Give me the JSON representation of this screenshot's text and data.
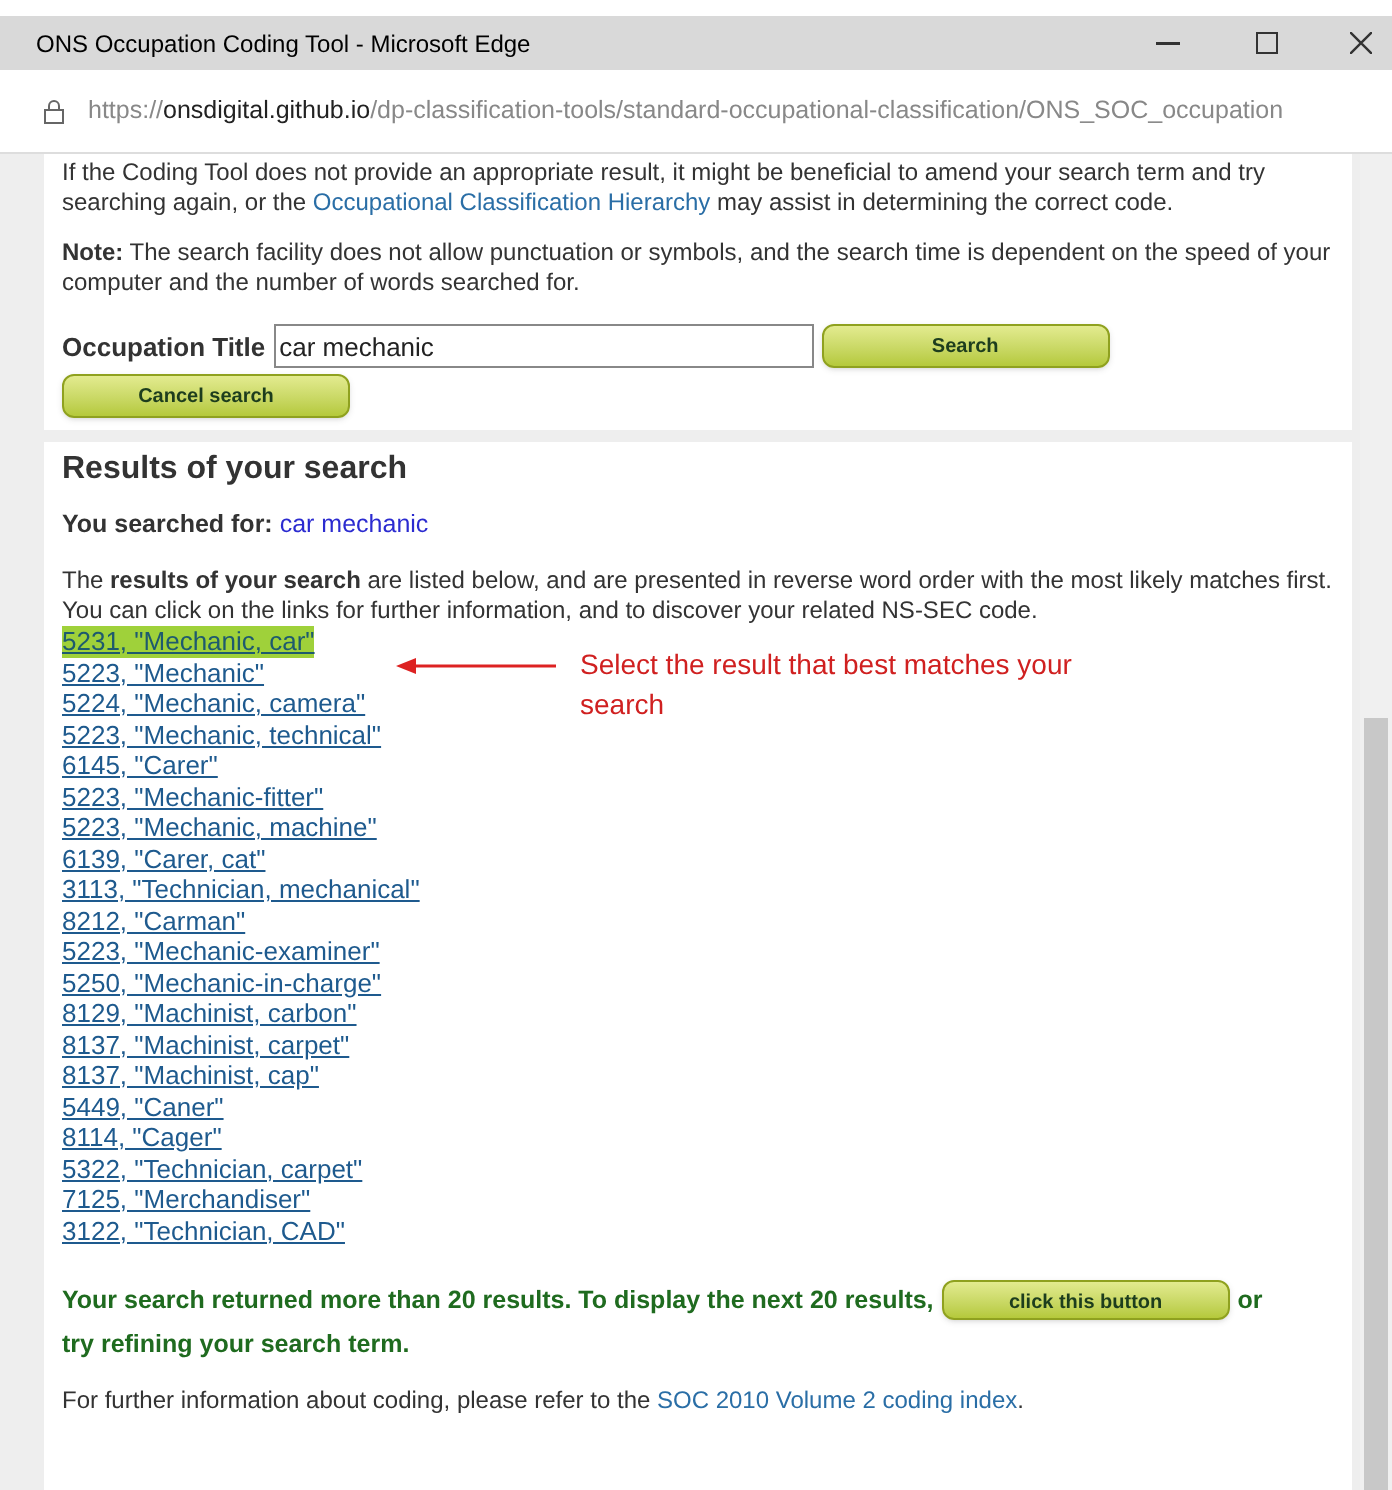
{
  "window": {
    "title": "ONS Occupation Coding Tool - Microsoft Edge"
  },
  "address_bar": {
    "url": "https://**onsdigital.github.io**/dp-classification-tools/standard-occupational-classification/ONS_SOC_occupation"
  },
  "intro": {
    "before": "If the Coding Tool does not provide an appropriate result, it might be beneficial to amend your search term and try searching again, or the ",
    "link": "Occupational Classification Hierarchy",
    "after": " may assist in determining the correct code."
  },
  "note": "**Note:** The search facility does not allow punctuation or symbols, and the search time is dependent on the speed of your computer and the number of words searched for.",
  "search_form": {
    "label": "Occupation Title",
    "value": "car mechanic",
    "search_button": "Search",
    "cancel_button": "Cancel search"
  },
  "results": {
    "heading": "Results of your search",
    "searched_label": "You searched for:",
    "searched_term": "car mechanic",
    "description": "The **results of your search** are listed below, and are presented in reverse word order with the most likely matches first. You can click on the links for further information, and to discover your related NS-SEC code.",
    "items": [
      {
        "label": "5231, \"Mechanic, car\"",
        "selected": true
      },
      {
        "label": "5223, \"Mechanic\"",
        "selected": false
      },
      {
        "label": "5224, \"Mechanic, camera\"",
        "selected": false
      },
      {
        "label": "5223, \"Mechanic, technical\"",
        "selected": false
      },
      {
        "label": "6145, \"Carer\"",
        "selected": false
      },
      {
        "label": "5223, \"Mechanic-fitter\"",
        "selected": false
      },
      {
        "label": "5223, \"Mechanic, machine\"",
        "selected": false
      },
      {
        "label": "6139, \"Carer, cat\"",
        "selected": false
      },
      {
        "label": "3113, \"Technician, mechanical\"",
        "selected": false
      },
      {
        "label": "8212, \"Carman\"",
        "selected": false
      },
      {
        "label": "5223, \"Mechanic-examiner\"",
        "selected": false
      },
      {
        "label": "5250, \"Mechanic-in-charge\"",
        "selected": false
      },
      {
        "label": "8129, \"Machinist, carbon\"",
        "selected": false
      },
      {
        "label": "8137, \"Machinist, carpet\"",
        "selected": false
      },
      {
        "label": "8137, \"Machinist, cap\"",
        "selected": false
      },
      {
        "label": "5449, \"Caner\"",
        "selected": false
      },
      {
        "label": "8114, \"Cager\"",
        "selected": false
      },
      {
        "label": "5322, \"Technician, carpet\"",
        "selected": false
      },
      {
        "label": "7125, \"Merchandiser\"",
        "selected": false
      },
      {
        "label": "3122, \"Technician, CAD\"",
        "selected": false
      }
    ],
    "annotation": "Select the result that best matches your search",
    "more_message": {
      "before": "Your search returned more than 20 results. To display the next 20 results,",
      "button": "click this button",
      "after": "or",
      "second_line": "try refining your search term."
    },
    "footer": {
      "before": "For further information about coding, please refer to the ",
      "link": "SOC 2010 Volume 2 coding index",
      "after": "."
    }
  }
}
